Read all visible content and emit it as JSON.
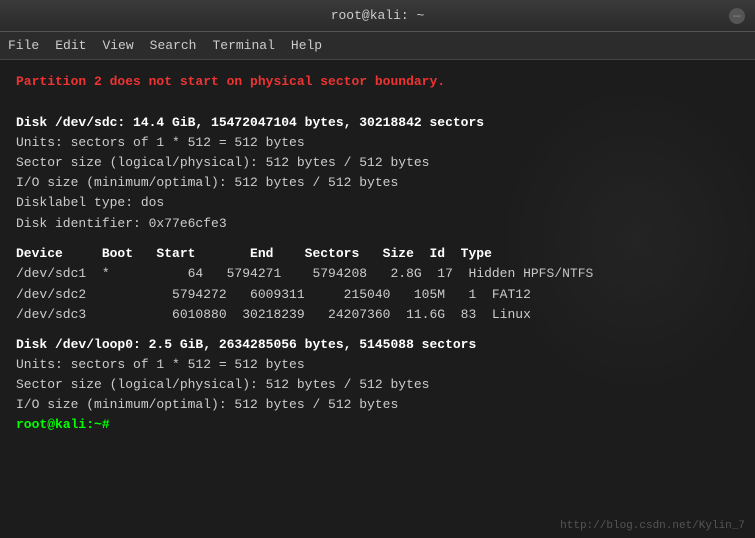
{
  "titlebar": {
    "title": "root@kali: ~",
    "btn_symbol": "—"
  },
  "menubar": {
    "items": [
      "File",
      "Edit",
      "View",
      "Search",
      "Terminal",
      "Help"
    ]
  },
  "terminal": {
    "warning": "Partition 2 does not start on physical sector boundary.",
    "disk1": {
      "header": "Disk /dev/sdc: 14.4 GiB, 15472047104 bytes, 30218842 sectors",
      "units": "Units: sectors of 1 * 512 = 512 bytes",
      "sector_size": "Sector size (logical/physical): 512 bytes / 512 bytes",
      "io_size": "I/O size (minimum/optimal): 512 bytes / 512 bytes",
      "disklabel": "Disklabel type: dos",
      "identifier": "Disk identifier: 0x77e6cfe3"
    },
    "table_header": "Device     Boot   Start       End    Sectors   Size  Id  Type",
    "table_rows": [
      "/dev/sdc1  *          64   5794271    5794208   2.8G  17  Hidden HPFS/NTFS",
      "/dev/sdc2           5794272   6009311     215040   105M   1  FAT12",
      "/dev/sdc3           6010880  30218239   24207360  11.6G  83  Linux"
    ],
    "disk2": {
      "header": "Disk /dev/loop0: 2.5 GiB, 2634285056 bytes, 5145088 sectors",
      "units": "Units: sectors of 1 * 512 = 512 bytes",
      "sector_size": "Sector size (logical/physical): 512 bytes / 512 bytes",
      "io_size": "I/O size (minimum/optimal): 512 bytes / 512 bytes"
    },
    "prompt": "root@kali:~#",
    "watermark": "http://blog.csdn.net/Kylin_7"
  }
}
